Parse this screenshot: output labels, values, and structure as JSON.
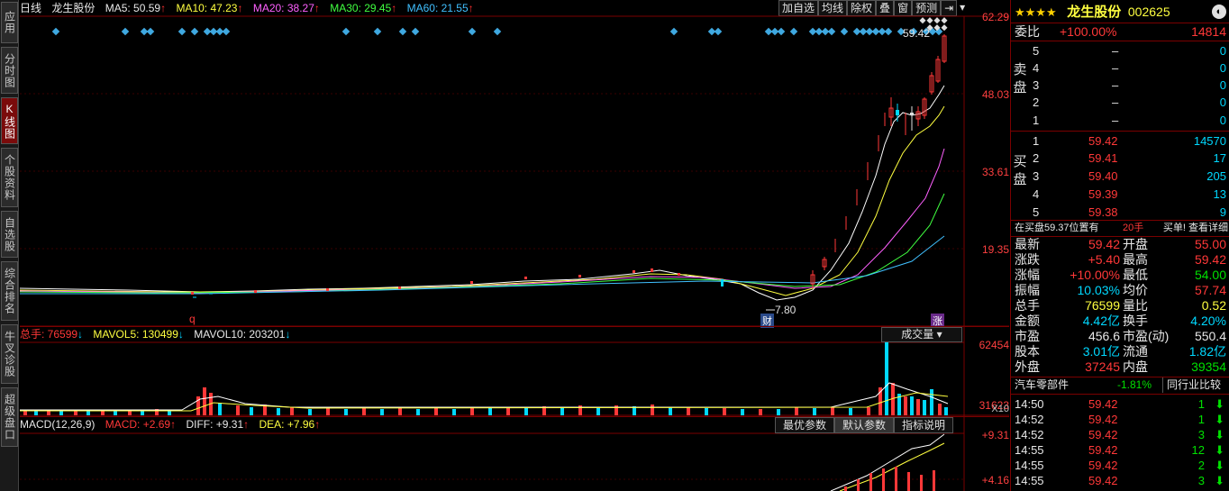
{
  "left_tabs": [
    {
      "label": "应用",
      "active": false
    },
    {
      "label": "分时图",
      "active": false
    },
    {
      "label": "K线图",
      "active": true
    },
    {
      "label": "个股资料",
      "active": false
    },
    {
      "label": "自选股",
      "active": false
    },
    {
      "label": "综合排名",
      "active": false
    },
    {
      "label": "牛叉诊股",
      "active": false
    },
    {
      "label": "超级盘口",
      "active": false
    }
  ],
  "kline_header": {
    "period": "日线",
    "stock": "龙生股份",
    "ma5": "MA5: 50.59",
    "ma10": "MA10: 47.23",
    "ma20": "MA20: 38.27",
    "ma30": "MA30: 29.45",
    "ma60": "MA60: 21.55"
  },
  "toolbar": [
    "加自选",
    "均线",
    "除权",
    "叠",
    "窗",
    "预测"
  ],
  "price_axis": [
    "62.29",
    "48.03",
    "33.61",
    "19.35"
  ],
  "annotations": {
    "high": "59.42",
    "low": "7.80",
    "cai": "财",
    "zhang": "涨",
    "q": "q"
  },
  "volume_header": {
    "total": "总手: 76599",
    "mavol5": "MAVOL5: 130499",
    "mavol10": "MAVOL10: 203201",
    "selector": "成交量"
  },
  "volume_axis": [
    "62454",
    "31623",
    "X10"
  ],
  "macd_header": {
    "params": "MACD(12,26,9)",
    "macd": "MACD: +2.69",
    "diff": "DIFF: +9.31",
    "dea": "DEA: +7.96"
  },
  "macd_tabs": [
    "最优参数",
    "默认参数",
    "指标说明"
  ],
  "macd_axis": [
    "+9.31",
    "+4.16"
  ],
  "quote": {
    "stars": "★★★★",
    "name": "龙生股份",
    "code": "002625",
    "weibi_label": "委比",
    "weibi": "+100.00%",
    "weicha": "14814",
    "sell_label": "卖盘",
    "buy_label": "买盘",
    "sell": [
      {
        "level": "5",
        "price": "–",
        "vol": "0"
      },
      {
        "level": "4",
        "price": "–",
        "vol": "0"
      },
      {
        "level": "3",
        "price": "–",
        "vol": "0"
      },
      {
        "level": "2",
        "price": "–",
        "vol": "0"
      },
      {
        "level": "1",
        "price": "–",
        "vol": "0"
      }
    ],
    "buy": [
      {
        "level": "1",
        "price": "59.42",
        "vol": "14570"
      },
      {
        "level": "2",
        "price": "59.41",
        "vol": "17"
      },
      {
        "level": "3",
        "price": "59.40",
        "vol": "205"
      },
      {
        "level": "4",
        "price": "59.39",
        "vol": "13"
      },
      {
        "level": "5",
        "price": "59.38",
        "vol": "9"
      }
    ],
    "notice": "在买盘59.37位置有",
    "notice_hands": "20手",
    "notice_link": "买单! 查看详细",
    "stats": [
      [
        "最新",
        "59.42",
        "开盘",
        "55.00"
      ],
      [
        "涨跌",
        "+5.40",
        "最高",
        "59.42"
      ],
      [
        "涨幅",
        "+10.00%",
        "最低",
        "54.00"
      ],
      [
        "振幅",
        "10.03%",
        "均价",
        "57.74"
      ],
      [
        "总手",
        "76599",
        "量比",
        "0.52"
      ],
      [
        "金额",
        "4.42亿",
        "换手",
        "4.20%"
      ],
      [
        "市盈",
        "456.6",
        "市盈(动)",
        "550.4"
      ],
      [
        "股本",
        "3.01亿",
        "流通",
        "1.82亿"
      ],
      [
        "外盘",
        "37245",
        "内盘",
        "39354"
      ]
    ],
    "industry": "汽车零部件",
    "industry_pct": "-1.81%",
    "industry_compare": "同行业比较",
    "ticks": [
      {
        "time": "14:50",
        "price": "59.42",
        "vol": "1"
      },
      {
        "time": "14:52",
        "price": "59.42",
        "vol": "1"
      },
      {
        "time": "14:52",
        "price": "59.42",
        "vol": "3"
      },
      {
        "time": "14:55",
        "price": "59.42",
        "vol": "12"
      },
      {
        "time": "14:55",
        "price": "59.42",
        "vol": "2"
      },
      {
        "time": "14:55",
        "price": "59.42",
        "vol": "3"
      }
    ]
  },
  "colors": {
    "up": "#ff3838",
    "down": "#00d8ff",
    "panel_border": "#7a0000"
  }
}
